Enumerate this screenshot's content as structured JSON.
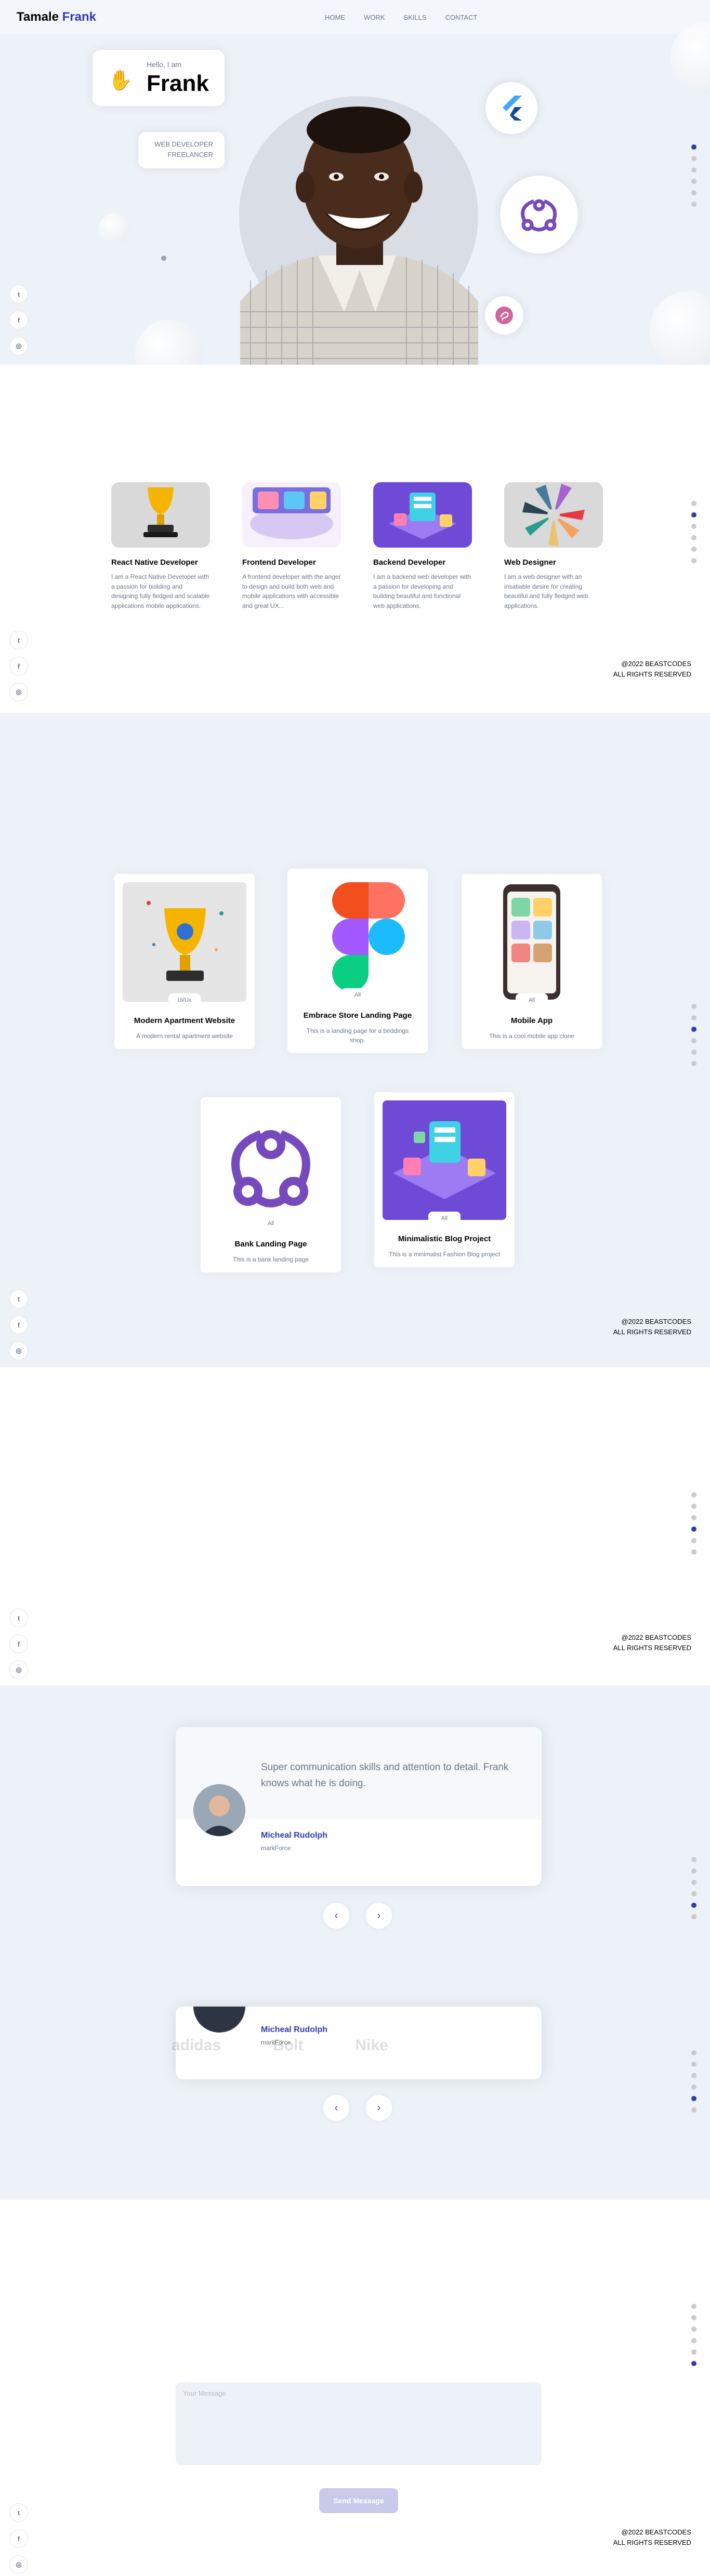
{
  "nav": {
    "logo_first": "Tamale",
    "logo_last": "Frank",
    "links": [
      "HOME",
      "WORK",
      "SKILLS",
      "CONTACT"
    ]
  },
  "social": {
    "twitter": "t",
    "facebook": "f",
    "instagram": "◎"
  },
  "hero": {
    "hello": "Hello, I am",
    "name": "Frank",
    "wave_icon": "✋",
    "role_line1": "WEB DEVELOPER",
    "role_line2": "FREELANCER",
    "bubbles": [
      "flutter-icon",
      "redux-icon",
      "sass-icon"
    ]
  },
  "about": {
    "cards": [
      {
        "title": "React Native Developer",
        "desc": "I am a React Native Developer with a passion for building and designing fully fledged and scalable applications mobile applications."
      },
      {
        "title": "Frontend Developer",
        "desc": "A frontend developer with the anger to design and build both web and mobile applications with accessible and great UX..."
      },
      {
        "title": "Backend Developer",
        "desc": "I am a backend web developer with a passion for developing and building beautiful and functional web applications."
      },
      {
        "title": "Web Designer",
        "desc": "I am a web designer with an insatiable desire for creating beautiful and fully fledged web applications."
      }
    ]
  },
  "work": {
    "projects": [
      {
        "title": "Modern Apartment Website",
        "desc": "A modern rental apartment website",
        "tag": "Ui/Ux"
      },
      {
        "title": "Embrace Store Landing Page",
        "desc": "This is a landing page for a beddings shop.",
        "tag": "All"
      },
      {
        "title": "Mobile App",
        "desc": "This is a cool mobile app clone",
        "tag": "All"
      },
      {
        "title": "Bank Landing Page",
        "desc": "This is a bank landing page",
        "tag": "All"
      },
      {
        "title": "Minimalistic Blog Project",
        "desc": "This is a minimalist Fashion Blog project",
        "tag": "All"
      }
    ]
  },
  "footer": {
    "line1": "@2022 BEASTCODES",
    "line2": "ALL RIGHTS RESERVED"
  },
  "testimonial": {
    "quote": "Super communication skills and attention to detail. Frank knows what he is doing.",
    "name": "Micheal Rudolph",
    "company": "markForce",
    "prev": "‹",
    "next": "›"
  },
  "brands": [
    "adidas",
    "Bolt",
    "Nike"
  ],
  "contact": {
    "message_placeholder": "Your Message",
    "send_label": "Send Message"
  },
  "colors": {
    "accent": "#313bac",
    "gray": "#6b7688",
    "bg": "#edf2f8"
  }
}
